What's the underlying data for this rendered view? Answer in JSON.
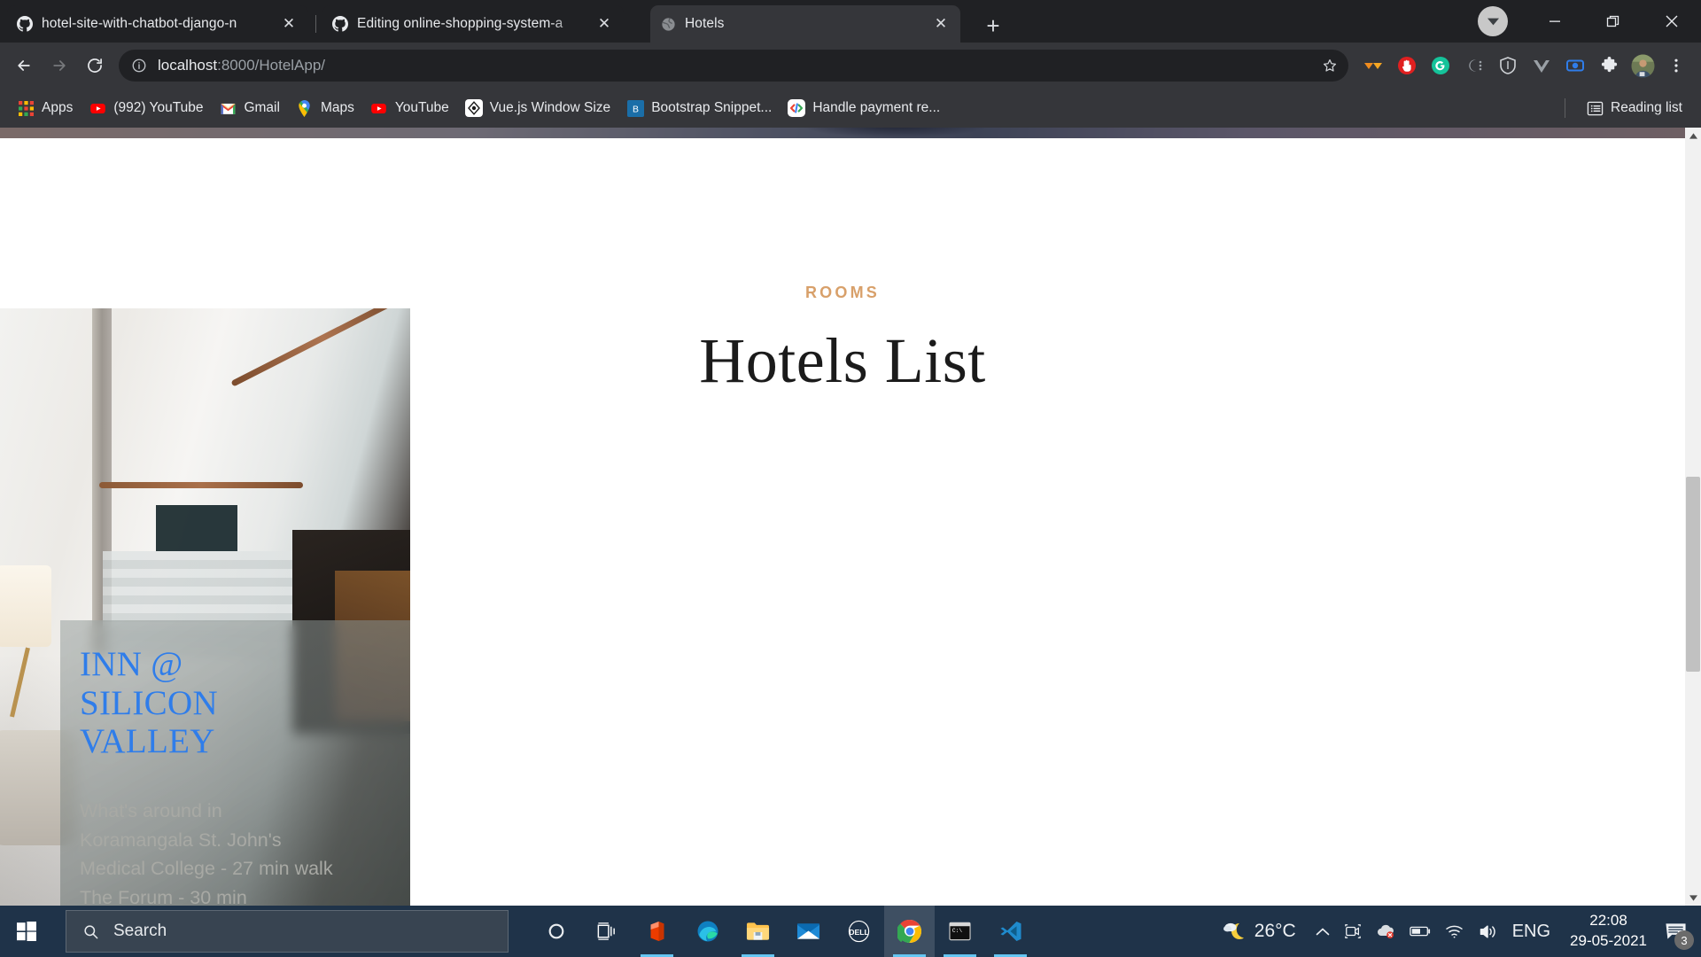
{
  "browser": {
    "tabs": [
      {
        "title": "hotel-site-with-chatbot-django-n",
        "favicon": "github-icon",
        "active": false
      },
      {
        "title": "Editing online-shopping-system-a",
        "favicon": "github-icon",
        "active": false
      },
      {
        "title": "Hotels",
        "favicon": "globe-icon",
        "active": true
      }
    ],
    "new_tab_label": "+",
    "close_label": "✕",
    "window_controls": {
      "minimize": "—",
      "maximize": "❐",
      "close": "✕"
    },
    "nav": {
      "back": "←",
      "forward": "→",
      "reload": "⟳"
    },
    "omnibox": {
      "host": "localhost",
      "rest": ":8000/HotelApp/",
      "site_info": "info-icon",
      "bookmark_star": "star-icon"
    },
    "extensions": [
      "adblock-orange-icon",
      "stop-hand-icon",
      "grammarly-icon",
      "colorzilla-icon",
      "privacy-shield-icon",
      "vue-devtools-icon",
      "screen-recorder-icon",
      "puzzle-extensions-icon"
    ],
    "profile": "avatar",
    "menu": "three-dot-menu-icon",
    "bookmarks": [
      {
        "label": "Apps",
        "icon": "apps-grid-icon"
      },
      {
        "label": "(992) YouTube",
        "icon": "youtube-icon"
      },
      {
        "label": "Gmail",
        "icon": "gmail-icon"
      },
      {
        "label": "Maps",
        "icon": "maps-pin-icon"
      },
      {
        "label": "YouTube",
        "icon": "youtube-icon"
      },
      {
        "label": "Vue.js Window Size",
        "icon": "vuejs-window-icon"
      },
      {
        "label": "Bootstrap Snippet...",
        "icon": "bootstrap-icon"
      },
      {
        "label": "Handle payment re...",
        "icon": "code-brackets-icon"
      }
    ],
    "reading_list": {
      "label": "Reading list",
      "icon": "reading-list-icon"
    }
  },
  "page": {
    "eyebrow": "ROOMS",
    "title": "Hotels List",
    "accent_color": "#d8a06a",
    "hotel_card": {
      "name": "INN @ SILICON VALLEY",
      "description": "What's around in Koramangala St. John's Medical College - 27 min walk The Forum - 30 min",
      "title_color": "#2f7dea"
    }
  },
  "taskbar": {
    "start": "windows-start-icon",
    "search_placeholder": "Search",
    "apps": [
      {
        "name": "cortana-icon"
      },
      {
        "name": "task-view-icon"
      },
      {
        "name": "office-icon"
      },
      {
        "name": "microsoft-edge-icon"
      },
      {
        "name": "file-explorer-icon"
      },
      {
        "name": "mail-icon"
      },
      {
        "name": "dell-icon"
      },
      {
        "name": "google-chrome-icon"
      },
      {
        "name": "command-prompt-icon"
      },
      {
        "name": "visual-studio-code-icon"
      }
    ],
    "tray": {
      "weather_icon": "moon-cloud-icon",
      "temperature": "26°C",
      "show_hidden": "chevron-up-icon",
      "icons": [
        "camera-icon",
        "onedrive-error-icon",
        "battery-icon",
        "wifi-icon",
        "volume-icon"
      ],
      "language": "ENG",
      "time": "22:08",
      "date": "29-05-2021",
      "notification_icon": "notification-icon",
      "notification_count": "3"
    }
  }
}
